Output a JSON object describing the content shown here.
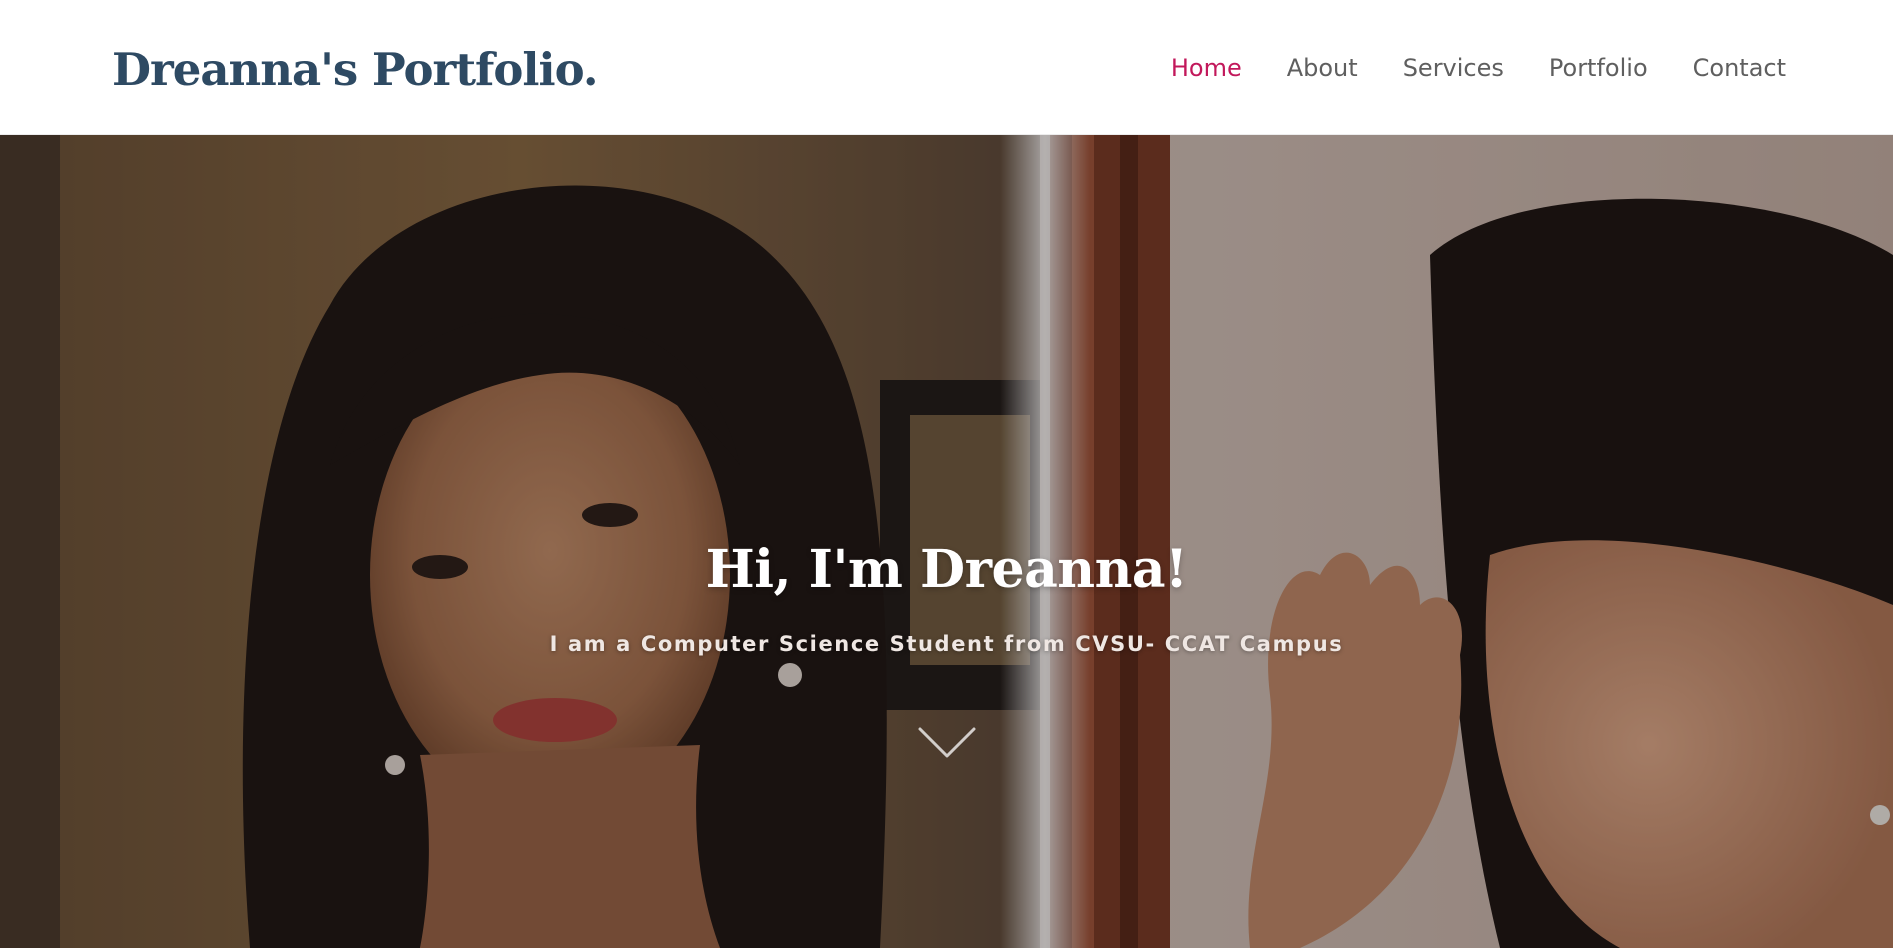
{
  "header": {
    "brand": "Dreanna's Portfolio.",
    "nav": [
      {
        "label": "Home",
        "active": true
      },
      {
        "label": "About",
        "active": false
      },
      {
        "label": "Services",
        "active": false
      },
      {
        "label": "Portfolio",
        "active": false
      },
      {
        "label": "Contact",
        "active": false
      }
    ]
  },
  "hero": {
    "title": "Hi, I'm Dreanna!",
    "subtitle": "I am a Computer Science Student from CVSU- CCAT Campus",
    "scroll_icon": "chevron-down-icon"
  },
  "colors": {
    "brand": "#2e4a63",
    "nav_active": "#c2185b",
    "nav_default": "#5f5f5f",
    "hero_text": "#ffffff"
  }
}
